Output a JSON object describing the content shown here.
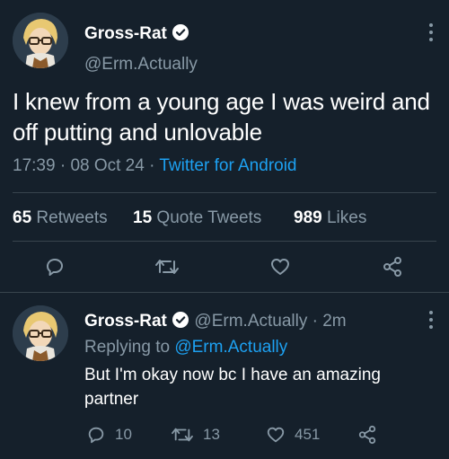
{
  "main_tweet": {
    "display_name": "Gross-Rat",
    "handle": "@Erm.Actually",
    "text": "I knew from a young age I was weird and off putting and unlovable",
    "time": "17:39",
    "date": "08 Oct 24",
    "source": "Twitter for Android",
    "stats": {
      "retweets_count": "65",
      "retweets_label": "Retweets",
      "quotes_count": "15",
      "quotes_label": "Quote Tweets",
      "likes_count": "989",
      "likes_label": "Likes"
    }
  },
  "reply": {
    "display_name": "Gross-Rat",
    "handle": "@Erm.Actually",
    "age": "2m",
    "replying_prefix": "Replying to",
    "replying_to": "@Erm.Actually",
    "text": "But I'm okay now bc I have an amazing partner",
    "replies": "10",
    "retweets": "13",
    "likes": "451"
  },
  "colors": {
    "background": "#15202b",
    "muted": "#8899a6",
    "accent": "#1da1f2",
    "divider": "#38444d"
  },
  "icons": [
    "verified-icon",
    "more-icon",
    "reply-icon",
    "retweet-icon",
    "like-icon",
    "share-icon"
  ]
}
